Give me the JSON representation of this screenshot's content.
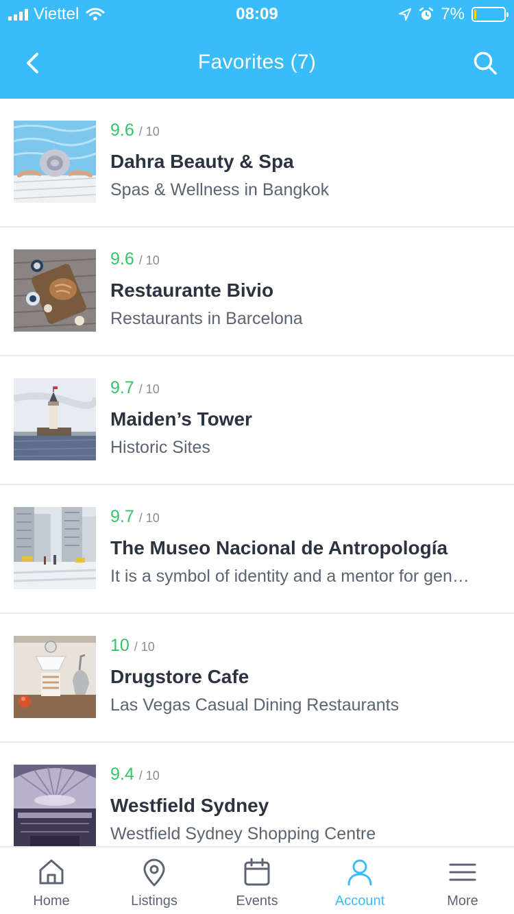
{
  "status_bar": {
    "carrier": "Viettel",
    "time": "08:09",
    "battery": "7%",
    "battery_level": 0.07
  },
  "nav": {
    "title": "Favorites (7)",
    "back_icon": "chevron-left-icon",
    "search_icon": "search-icon"
  },
  "items": [
    {
      "score": "9.6",
      "max": "/ 10",
      "name": "Dahra Beauty & Spa",
      "subtitle": "Spas & Wellness in Bangkok",
      "image": "pool-hat-photo"
    },
    {
      "score": "9.6",
      "max": "/ 10",
      "name": "Restaurante Bivio",
      "subtitle": "Restaurants in Barcelona",
      "image": "bread-board-photo"
    },
    {
      "score": "9.7",
      "max": "/ 10",
      "name": "Maiden’s Tower",
      "subtitle": "Historic Sites",
      "image": "tower-sea-photo"
    },
    {
      "score": "9.7",
      "max": "/ 10",
      "name": "The Museo Nacional de Antropología",
      "subtitle": "It is a symbol of identity and a mentor for gen…",
      "image": "city-street-photo"
    },
    {
      "score": "10",
      "max": "/ 10",
      "name": "Drugstore Cafe",
      "subtitle": "Las Vegas Casual Dining Restaurants",
      "image": "coffee-drip-photo"
    },
    {
      "score": "9.4",
      "max": "/ 10",
      "name": "Westfield Sydney",
      "subtitle": "Westfield Sydney Shopping Centre",
      "image": "mall-dome-photo"
    }
  ],
  "tabs": [
    {
      "label": "Home",
      "icon": "home-icon",
      "active": false
    },
    {
      "label": "Listings",
      "icon": "map-pin-icon",
      "active": false
    },
    {
      "label": "Events",
      "icon": "calendar-icon",
      "active": false
    },
    {
      "label": "Account",
      "icon": "user-icon",
      "active": true
    },
    {
      "label": "More",
      "icon": "menu-icon",
      "active": false
    }
  ],
  "colors": {
    "brand": "#3bbcfa",
    "score": "#34c36b",
    "title_text": "#2b3340",
    "subtitle_text": "#5b6472",
    "battery_fill": "#ffd21a"
  }
}
